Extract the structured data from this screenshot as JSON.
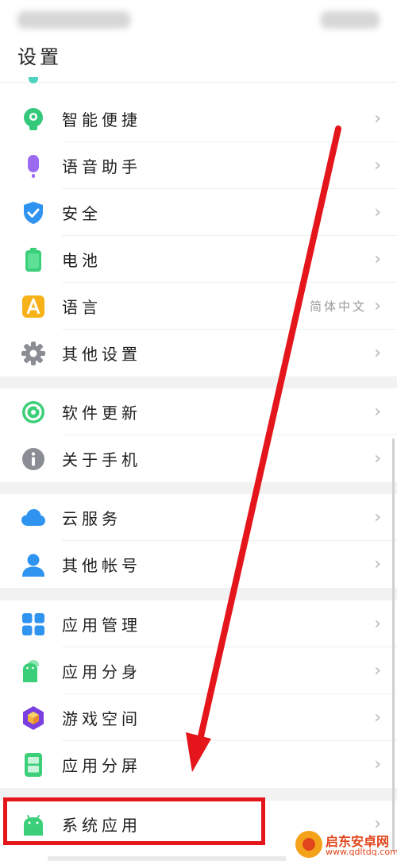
{
  "page": {
    "title": "设置"
  },
  "rows": [
    {
      "id": "smart",
      "label": "智能便捷",
      "icon": "smart-assist-icon",
      "value": ""
    },
    {
      "id": "voice",
      "label": "语音助手",
      "icon": "microphone-icon",
      "value": ""
    },
    {
      "id": "security",
      "label": "安全",
      "icon": "shield-icon",
      "value": ""
    },
    {
      "id": "battery",
      "label": "电池",
      "icon": "battery-icon",
      "value": ""
    },
    {
      "id": "language",
      "label": "语言",
      "icon": "language-icon",
      "value": "简体中文"
    },
    {
      "id": "other",
      "label": "其他设置",
      "icon": "gear-icon",
      "value": ""
    },
    {
      "id": "update",
      "label": "软件更新",
      "icon": "update-icon",
      "value": ""
    },
    {
      "id": "about",
      "label": "关于手机",
      "icon": "info-icon",
      "value": ""
    },
    {
      "id": "cloud",
      "label": "云服务",
      "icon": "cloud-icon",
      "value": ""
    },
    {
      "id": "accounts",
      "label": "其他帐号",
      "icon": "user-icon",
      "value": ""
    },
    {
      "id": "appmgr",
      "label": "应用管理",
      "icon": "app-grid-icon",
      "value": ""
    },
    {
      "id": "clone",
      "label": "应用分身",
      "icon": "android-clone-icon",
      "value": ""
    },
    {
      "id": "game",
      "label": "游戏空间",
      "icon": "game-cube-icon",
      "value": ""
    },
    {
      "id": "split",
      "label": "应用分屏",
      "icon": "split-screen-icon",
      "value": ""
    },
    {
      "id": "system",
      "label": "系统应用",
      "icon": "android-icon",
      "value": ""
    }
  ],
  "chevron": "›",
  "watermark": {
    "title": "启东安卓网",
    "url": "www.qdltdq.com"
  },
  "colors": {
    "annotation": "#e4151b",
    "green": "#3ccf7a",
    "blue": "#2f93f0"
  }
}
